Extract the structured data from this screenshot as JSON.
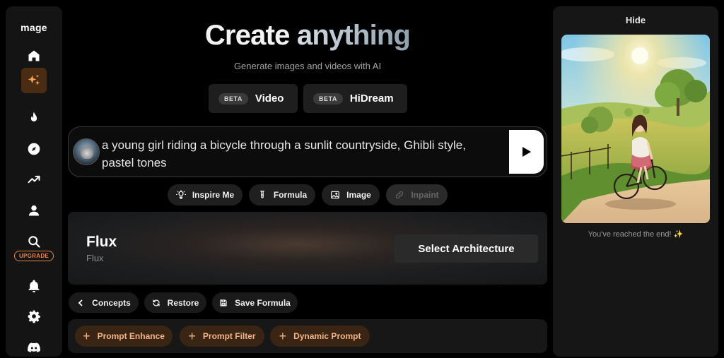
{
  "app": {
    "logo": "mage"
  },
  "sidebar": {
    "items": [
      {
        "icon": "home-icon"
      },
      {
        "icon": "sparkles-icon",
        "active": true
      },
      {
        "icon": "flame-icon"
      },
      {
        "icon": "compass-icon"
      },
      {
        "icon": "trending-icon"
      },
      {
        "icon": "user-icon"
      },
      {
        "icon": "search-icon"
      },
      {
        "icon": "bell-icon"
      },
      {
        "icon": "gear-icon"
      },
      {
        "icon": "discord-icon"
      }
    ],
    "upgrade_label": "UPGRADE"
  },
  "hero": {
    "title_part1": "Create",
    "title_part2": "anything",
    "subtitle": "Generate images and videos with AI"
  },
  "modes": [
    {
      "badge": "BETA",
      "label": "Video"
    },
    {
      "badge": "BETA",
      "label": "HiDream"
    }
  ],
  "prompt": {
    "text": "a young girl riding a bicycle through a sunlit countryside, Ghibli style, pastel tones"
  },
  "chips": {
    "inspire": "Inspire Me",
    "formula": "Formula",
    "image": "Image",
    "inpaint": "Inpaint"
  },
  "architecture": {
    "name": "Flux",
    "subtitle": "Flux",
    "select_label": "Select Architecture"
  },
  "tools": {
    "concepts": "Concepts",
    "restore": "Restore",
    "save_formula": "Save Formula"
  },
  "addons": {
    "prompt_enhance": "Prompt Enhance",
    "prompt_filter": "Prompt Filter",
    "dynamic_prompt": "Dynamic Prompt"
  },
  "right_panel": {
    "hide_label": "Hide",
    "end_text": "You've reached the end!",
    "end_emoji": "✨"
  },
  "colors": {
    "accent": "#f0873a",
    "accent_chip_bg": "#3a2414",
    "accent_chip_text": "#f2b486",
    "active_nav_bg": "#4a2c12"
  }
}
